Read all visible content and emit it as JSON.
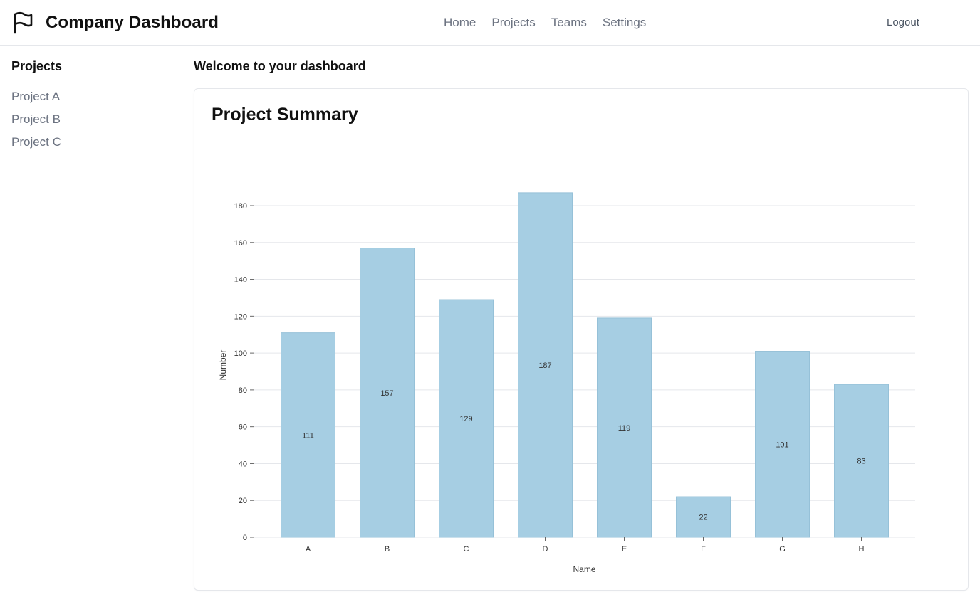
{
  "header": {
    "brand_icon": "flag-icon",
    "title": "Company Dashboard",
    "nav": [
      "Home",
      "Projects",
      "Teams",
      "Settings"
    ],
    "logout_label": "Logout"
  },
  "sidebar": {
    "title": "Projects",
    "items": [
      {
        "label": "Project A"
      },
      {
        "label": "Project B"
      },
      {
        "label": "Project C"
      }
    ]
  },
  "main": {
    "welcome": "Welcome to your dashboard",
    "card_title": "Project Summary"
  },
  "colors": {
    "bar": "#a6cee3",
    "bar_stroke": "#96c1d8",
    "grid": "#e5e7eb",
    "axis_text": "#333333",
    "muted_text": "#6b7280"
  },
  "chart_data": {
    "type": "bar",
    "categories": [
      "A",
      "B",
      "C",
      "D",
      "E",
      "F",
      "G",
      "H"
    ],
    "values": [
      111,
      157,
      129,
      187,
      119,
      22,
      101,
      83
    ],
    "xlabel": "Name",
    "ylabel": "Number",
    "yticks": [
      0,
      20,
      40,
      60,
      80,
      100,
      120,
      140,
      160,
      180
    ],
    "ylim": [
      0,
      180
    ],
    "grid": true,
    "data_labels": true
  }
}
